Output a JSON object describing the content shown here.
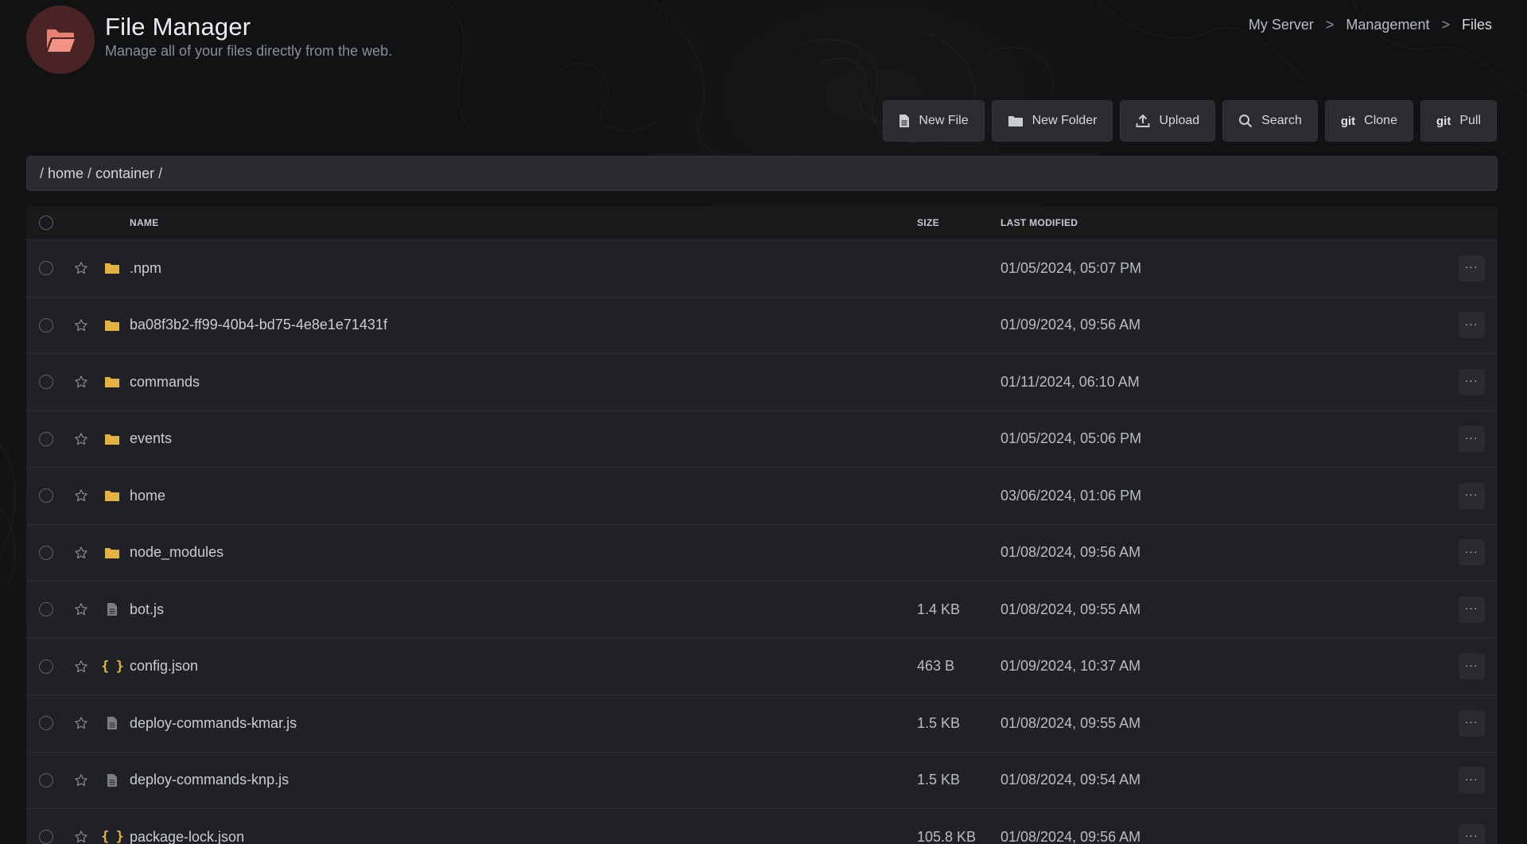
{
  "header": {
    "title": "File Manager",
    "subtitle": "Manage all of your files directly from the web.",
    "logo_icon": "folder-open-icon",
    "accent": "#e8806f"
  },
  "breadcrumb": {
    "items": [
      "My Server",
      "Management",
      "Files"
    ],
    "separator": ">"
  },
  "toolbar": {
    "new_file": "New File",
    "new_folder": "New Folder",
    "upload": "Upload",
    "search": "Search",
    "clone_prefix": "git",
    "clone": "Clone",
    "pull_prefix": "git",
    "pull": "Pull"
  },
  "path": {
    "segments": [
      "home",
      "container"
    ],
    "separator": "/"
  },
  "table": {
    "columns": {
      "name": "NAME",
      "size": "SIZE",
      "modified": "LAST MODIFIED"
    },
    "menu_label": "···",
    "folder_color": "#e3b341",
    "rows": [
      {
        "type": "folder",
        "name": ".npm",
        "size": "",
        "modified": "01/05/2024, 05:07 PM"
      },
      {
        "type": "folder",
        "name": "ba08f3b2-ff99-40b4-bd75-4e8e1e71431f",
        "size": "",
        "modified": "01/09/2024, 09:56 AM"
      },
      {
        "type": "folder",
        "name": "commands",
        "size": "",
        "modified": "01/11/2024, 06:10 AM"
      },
      {
        "type": "folder",
        "name": "events",
        "size": "",
        "modified": "01/05/2024, 05:06 PM"
      },
      {
        "type": "folder",
        "name": "home",
        "size": "",
        "modified": "03/06/2024, 01:06 PM"
      },
      {
        "type": "folder",
        "name": "node_modules",
        "size": "",
        "modified": "01/08/2024, 09:56 AM"
      },
      {
        "type": "file",
        "name": "bot.js",
        "size": "1.4 KB",
        "modified": "01/08/2024, 09:55 AM"
      },
      {
        "type": "json",
        "name": "config.json",
        "size": "463 B",
        "modified": "01/09/2024, 10:37 AM"
      },
      {
        "type": "file",
        "name": "deploy-commands-kmar.js",
        "size": "1.5 KB",
        "modified": "01/08/2024, 09:55 AM"
      },
      {
        "type": "file",
        "name": "deploy-commands-knp.js",
        "size": "1.5 KB",
        "modified": "01/08/2024, 09:54 AM"
      },
      {
        "type": "json",
        "name": "package-lock.json",
        "size": "105.8 KB",
        "modified": "01/08/2024, 09:56 AM"
      }
    ]
  }
}
